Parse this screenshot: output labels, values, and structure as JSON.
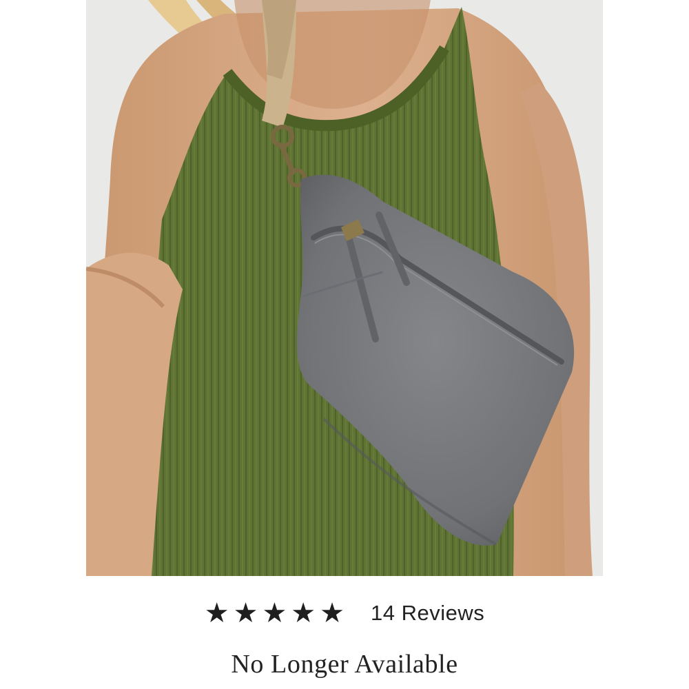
{
  "product": {
    "image_alt": "Grey suede sling bag worn over a green ribbed tank top",
    "rating": {
      "value": 5,
      "max": 5
    },
    "reviews_label": "14 Reviews",
    "availability": "No Longer Available"
  },
  "colors": {
    "tank": "#5f7434",
    "bag": "#787a7d",
    "skin": "#d9ad8b",
    "background": "#e9e9e7",
    "strap": "#cbb38d",
    "text": "#222222"
  },
  "icons": [
    "star-icon"
  ]
}
